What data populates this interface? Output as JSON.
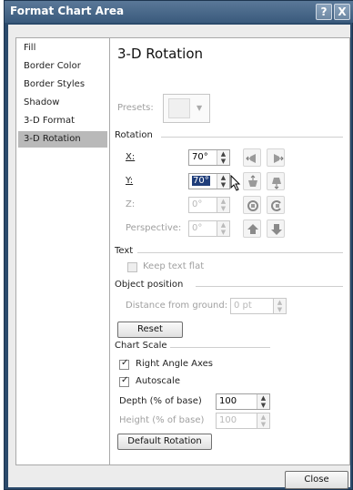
{
  "window": {
    "title": "Format Chart Area",
    "help_label": "?",
    "close_label": "X"
  },
  "sidebar": {
    "items": [
      {
        "label": "Fill"
      },
      {
        "label": "Border Color"
      },
      {
        "label": "Border Styles"
      },
      {
        "label": "Shadow"
      },
      {
        "label": "3-D Format"
      },
      {
        "label": "3-D Rotation",
        "selected": true
      }
    ]
  },
  "panel": {
    "heading": "3-D Rotation",
    "presets_label": "Presets:",
    "rotation_section": "Rotation",
    "x_label": "X:",
    "x_value": "70°",
    "y_label": "Y:",
    "y_value": "70°",
    "z_label": "Z:",
    "z_value": "0°",
    "perspective_label": "Perspective:",
    "perspective_value": "0°",
    "text_section": "Text",
    "keep_text_flat_label": "Keep text flat",
    "object_position_section": "Object position",
    "distance_label": "Distance from ground:",
    "distance_value": "0 pt",
    "reset_label": "Reset",
    "chart_scale_section": "Chart Scale",
    "right_angle_axes_label": "Right Angle Axes",
    "right_angle_axes_checked": true,
    "autoscale_label": "Autoscale",
    "autoscale_checked": true,
    "depth_label": "Depth (% of base)",
    "depth_value": "100",
    "height_label": "Height (% of base)",
    "height_value": "100",
    "default_rotation_label": "Default Rotation"
  },
  "footer": {
    "close_label": "Close"
  },
  "colors": {
    "titlebar": "#3a5a7c",
    "selected_nav": "#b9b9b9",
    "panel_bg": "#ffffff",
    "dialog_bg": "#ececec"
  }
}
